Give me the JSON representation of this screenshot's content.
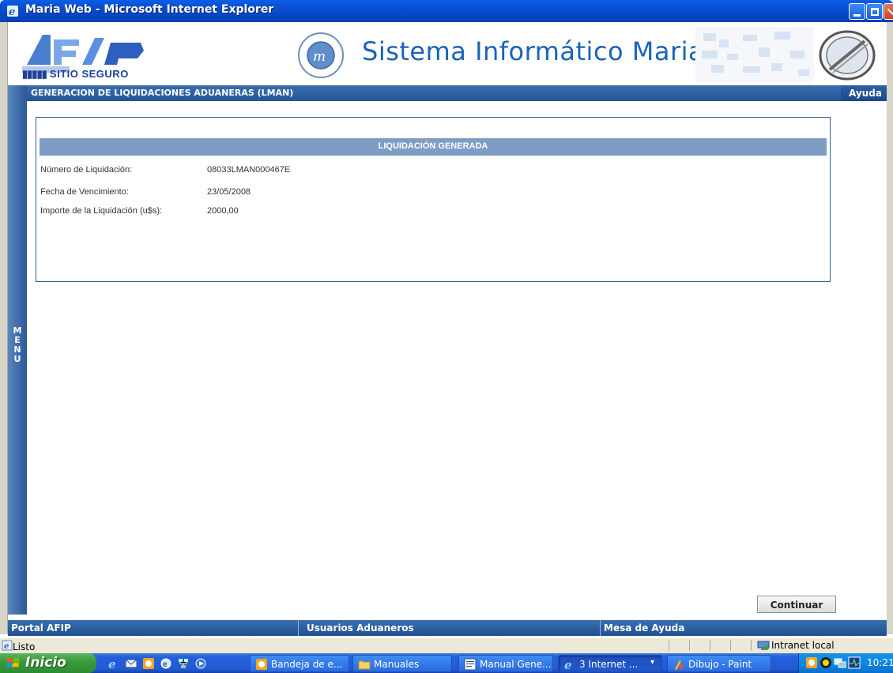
{
  "window": {
    "title": "Maria Web - Microsoft Internet Explorer"
  },
  "header": {
    "logo_text": "AFIP",
    "secure_text": "SITIO SEGURO",
    "system_title": "Sistema Informático Maria"
  },
  "section": {
    "title": "GENERACION DE LIQUIDACIONES ADUANERAS (LMAN)",
    "help_label": "Ayuda"
  },
  "menu": {
    "label": "MENU",
    "letters": [
      "M",
      "E",
      "N",
      "U"
    ]
  },
  "panel": {
    "title": "LIQUIDACIÓN GENERADA",
    "fields": [
      {
        "label": "Número de Liquidación:",
        "value": "08033LMAN000467E"
      },
      {
        "label": "Fecha de Vencimiento:",
        "value": "23/05/2008"
      },
      {
        "label": "Importe de la Liquidación (u$s):",
        "value": "2000,00"
      }
    ]
  },
  "actions": {
    "continue_label": "Continuar"
  },
  "footer": {
    "links": [
      "Portal AFIP",
      "Usuarios Aduaneros",
      "Mesa de Ayuda"
    ]
  },
  "statusbar": {
    "status": "Listo",
    "zone": "Intranet local"
  },
  "taskbar": {
    "start_label": "Inicio",
    "tasks": [
      {
        "label": "Bandeja de e...",
        "icon": "outlook-icon"
      },
      {
        "label": "Manuales",
        "icon": "folder-icon"
      },
      {
        "label": "Manual Gene...",
        "icon": "word-icon"
      },
      {
        "label": "3 Internet ...",
        "icon": "ie-icon"
      },
      {
        "label": "Dibujo - Paint",
        "icon": "paint-icon"
      }
    ],
    "clock": "10:21"
  },
  "colors": {
    "section_bar": "#225595",
    "panel_header": "#7f9dc4",
    "title_blue": "#1a63b8",
    "panel_border": "#2c5f97"
  }
}
